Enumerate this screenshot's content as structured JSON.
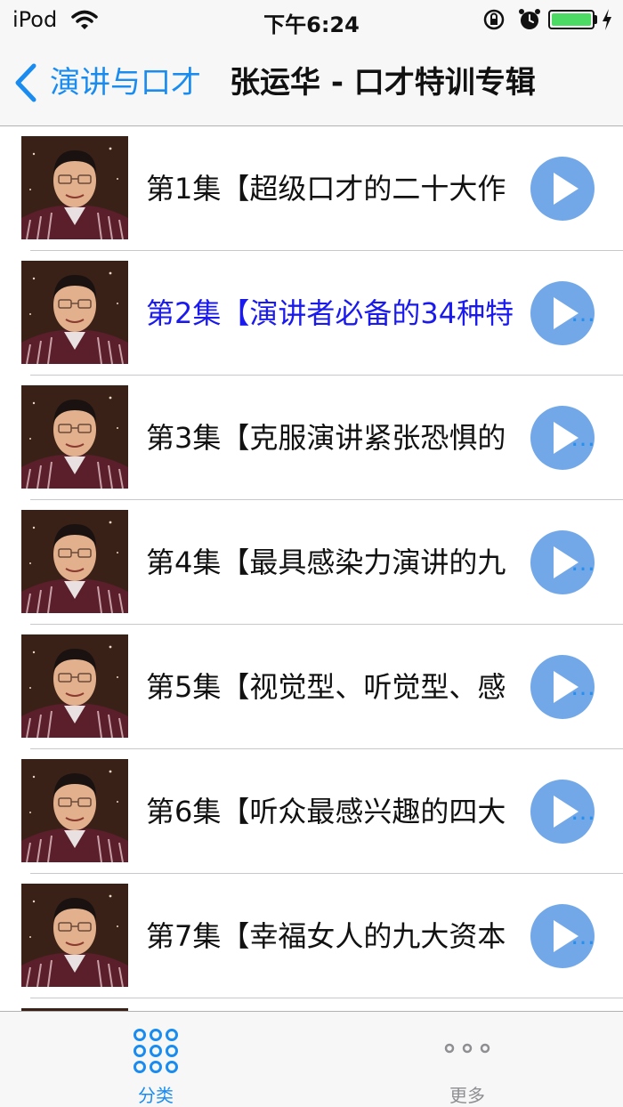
{
  "status_bar": {
    "carrier": "iPod",
    "time": "下午6:24",
    "battery_level": 1.0
  },
  "nav": {
    "back_label": "演讲与口才",
    "title": "张运华 - 口才特训专辑"
  },
  "episodes": [
    {
      "label": "第1集【超级口才的二十大作"
    },
    {
      "label": "第2集【演讲者必备的34种特"
    },
    {
      "label": "第3集【克服演讲紧张恐惧的"
    },
    {
      "label": "第4集【最具感染力演讲的九"
    },
    {
      "label": "第5集【视觉型、听觉型、感"
    },
    {
      "label": "第6集【听众最感兴趣的四大"
    },
    {
      "label": "第7集【幸福女人的九大资本"
    }
  ],
  "ellipsis": "…",
  "tab_bar": {
    "left_label": "分类",
    "right_label": "更多"
  },
  "colors": {
    "accent": "#1a8cf0",
    "active_row_text": "#1a1aee",
    "battery": "#4cd964"
  }
}
